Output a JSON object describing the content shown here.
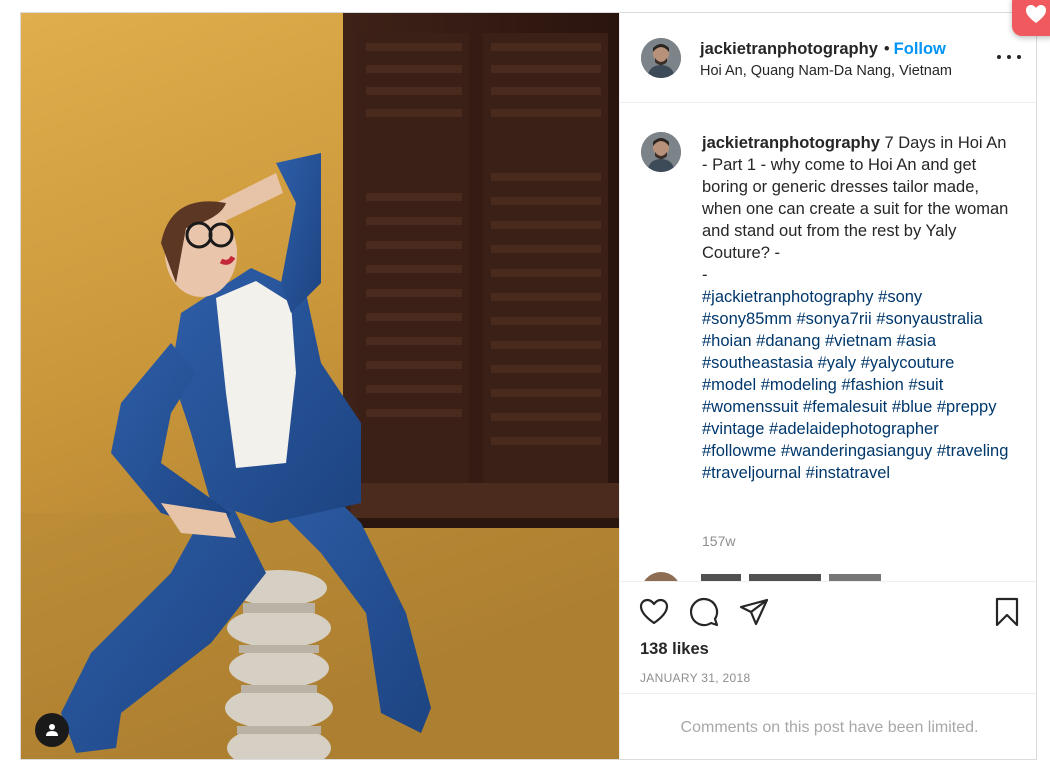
{
  "post": {
    "username": "jackietranphotography",
    "follow_label": "Follow",
    "separator": "•",
    "location": "Hoi An, Quang Nam-Da Nang, Vietnam",
    "caption_username": "jackietranphotography",
    "caption_text": " 7 Days in Hoi An - Part 1 - why come to Hoi An and get boring or generic dresses tailor made, when one can create a suit for the woman and stand out from the rest by Yaly Couture? -",
    "caption_dash": "-",
    "hashtags": [
      "#jackietranphotography",
      "#sony",
      "#sony85mm",
      "#sonya7rii",
      "#sonyaustralia",
      "#hoian",
      "#danang",
      "#vietnam",
      "#asia",
      "#southeastasia",
      "#yaly",
      "#yalycouture",
      "#model",
      "#modeling",
      "#fashion",
      "#suit",
      "#womenssuit",
      "#femalesuit",
      "#blue",
      "#preppy",
      "#vintage",
      "#adelaidephotographer",
      "#followme",
      "#wanderingasianguy",
      "#traveling",
      "#traveljournal",
      "#instatravel"
    ],
    "age": "157w",
    "likes": "138 likes",
    "date": "JANUARY 31, 2018",
    "comments_limited": "Comments on this post have been limited."
  },
  "icons": {
    "like": "heart-outline-icon",
    "comment": "speech-bubble-icon",
    "share": "paper-plane-icon",
    "save": "bookmark-icon",
    "more": "three-dots-icon",
    "tagged_user": "person-icon",
    "floating": "heart-filled-icon"
  },
  "colors": {
    "follow": "#0095f6",
    "hashtag": "#00376b",
    "muted": "#8e8e8e",
    "floating_button": "#f05a5e"
  }
}
